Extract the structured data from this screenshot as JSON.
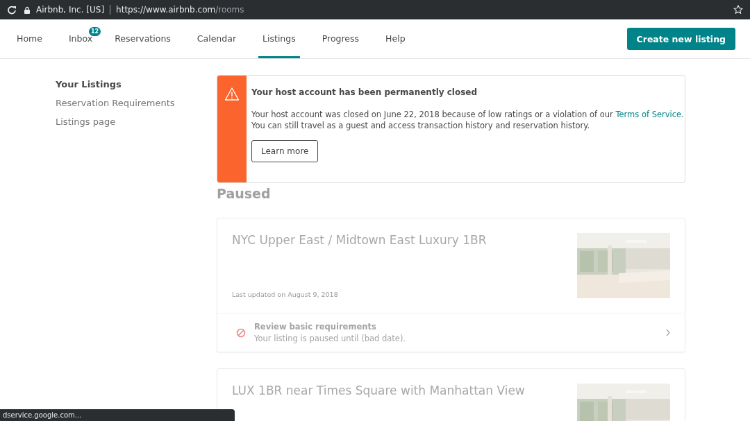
{
  "browser": {
    "site_identity": "Airbnb, Inc. [US]",
    "url_host": "https://www.airbnb.com",
    "url_path": "/rooms"
  },
  "nav": {
    "items": [
      {
        "label": "Home",
        "selected": false
      },
      {
        "label": "Inbox",
        "selected": false,
        "badge": "12"
      },
      {
        "label": "Reservations",
        "selected": false
      },
      {
        "label": "Calendar",
        "selected": false
      },
      {
        "label": "Listings",
        "selected": true
      },
      {
        "label": "Progress",
        "selected": false
      },
      {
        "label": "Help",
        "selected": false
      }
    ],
    "action_button": "Create new listing"
  },
  "sidebar": {
    "items": [
      {
        "label": "Your Listings",
        "selected": true
      },
      {
        "label": "Reservation Requirements",
        "selected": false
      },
      {
        "label": "Listings page",
        "selected": false
      }
    ]
  },
  "alert": {
    "title": "Your host account has been permanently closed",
    "body": "Your host account was closed on June 22, 2018 because of low ratings or a violation of our",
    "link": "Terms of Service",
    "body_end": ".",
    "body_2": "You can still travel as a guest and access transaction history and reservation history.",
    "button": "Learn more"
  },
  "section_title": "Paused",
  "listings": [
    {
      "title": "NYC Upper East / Midtown East Luxury 1BR",
      "updated": "Last updated on August 9, 2018",
      "requirement": {
        "title": "Review basic requirements",
        "detail": "Your listing is paused until (bad date)."
      }
    },
    {
      "title": "LUX 1BR near Times Square with Manhattan View"
    }
  ],
  "status_tooltip": "dservice.google.com..."
}
